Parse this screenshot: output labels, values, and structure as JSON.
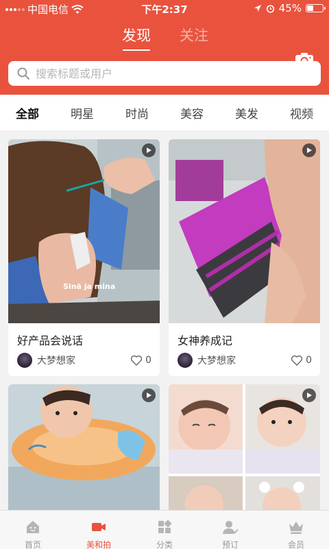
{
  "status_bar": {
    "carrier": "中国电信",
    "time": "下午2:37",
    "battery_percent": "45%",
    "battery_level": 0.45
  },
  "top_tabs": [
    {
      "label": "发现",
      "active": true
    },
    {
      "label": "关注",
      "active": false
    }
  ],
  "search": {
    "placeholder": "搜索标题或用户"
  },
  "categories": [
    {
      "label": "全部",
      "active": true
    },
    {
      "label": "明星",
      "active": false
    },
    {
      "label": "时尚",
      "active": false
    },
    {
      "label": "美容",
      "active": false
    },
    {
      "label": "美发",
      "active": false
    },
    {
      "label": "视频",
      "active": false
    }
  ],
  "feed": [
    {
      "title": "好产品会说话",
      "author": "大梦想家",
      "likes": "0",
      "overlay_text": "Sinä ja mina",
      "is_video": true
    },
    {
      "title": "女神养成记",
      "author": "大梦想家",
      "likes": "0",
      "is_video": true
    },
    {
      "is_video": true
    },
    {
      "is_video": true
    }
  ],
  "bottom_nav": [
    {
      "label": "首页",
      "icon": "home-icon",
      "active": false
    },
    {
      "label": "美和拍",
      "icon": "video-camera-icon",
      "active": true
    },
    {
      "label": "分类",
      "icon": "grid-icon",
      "active": false
    },
    {
      "label": "预订",
      "icon": "user-check-icon",
      "active": false
    },
    {
      "label": "会员",
      "icon": "crown-icon",
      "active": false
    }
  ],
  "colors": {
    "brand_red": "#e9533e",
    "inactive_gray": "#999999"
  }
}
